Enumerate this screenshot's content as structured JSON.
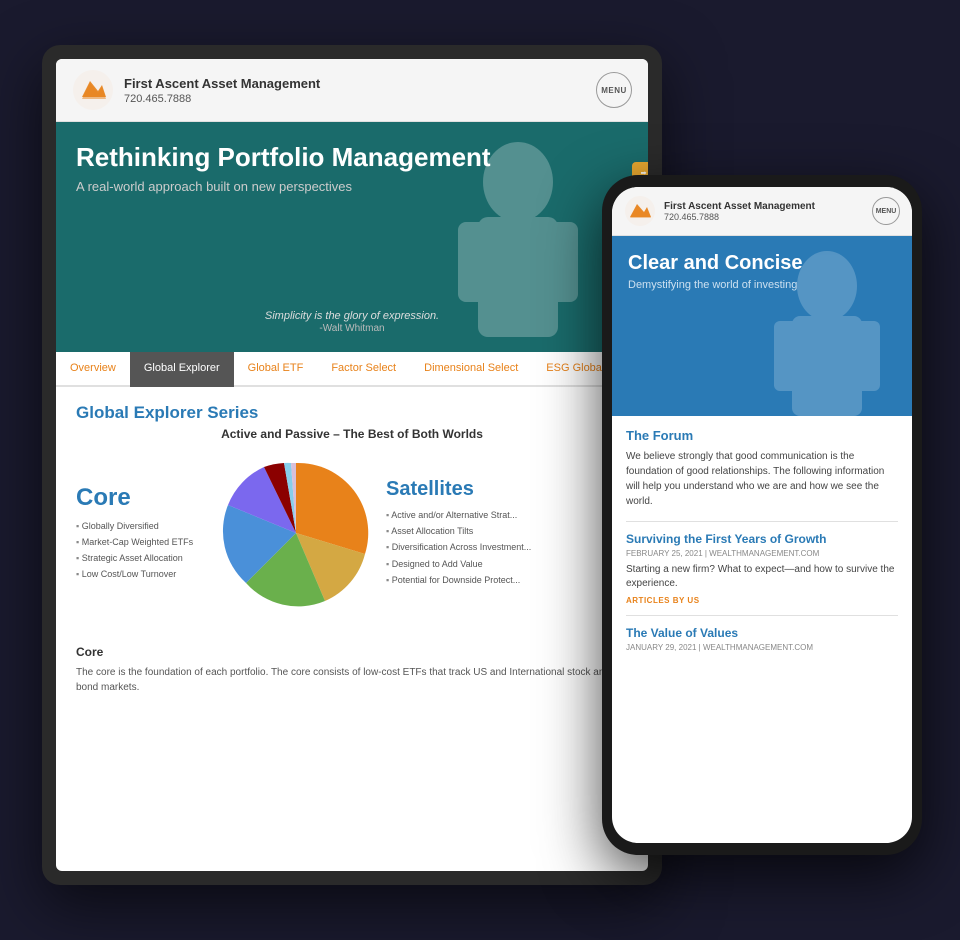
{
  "desktop": {
    "header": {
      "company_name": "First Ascent Asset Management",
      "phone": "720.465.7888",
      "menu_label": "MENU"
    },
    "hero": {
      "title": "Rethinking Portfolio Management",
      "subtitle": "A real-world approach built on new perspectives",
      "quote": "Simplicity is the glory of expression.",
      "quote_attribution": "-Walt Whitman"
    },
    "tabs": [
      {
        "label": "Overview",
        "active": false
      },
      {
        "label": "Global Explorer",
        "active": true
      },
      {
        "label": "Global ETF",
        "active": false
      },
      {
        "label": "Factor Select",
        "active": false
      },
      {
        "label": "Dimensional Select",
        "active": false
      },
      {
        "label": "ESG Global Core",
        "active": false
      }
    ],
    "section_title": "Global Explorer Series",
    "chart_title": "Active and Passive – The Best of Both Worlds",
    "core": {
      "label": "Core",
      "items": [
        "Globally Diversified",
        "Market-Cap Weighted ETFs",
        "Strategic Asset Allocation",
        "Low Cost/Low Turnover"
      ]
    },
    "satellites": {
      "label": "Satellites",
      "items": [
        "Active and/or Alternative Strat...",
        "Asset Allocation Tilts",
        "Diversification Across Investment...",
        "Designed to Add Value",
        "Potential for Downside Protect..."
      ]
    },
    "bottom_section": {
      "title": "Core",
      "text": "The core is the foundation of each portfolio.  The core consists of low-cost ETFs that track US and International stock and bond markets."
    },
    "pie_segments": [
      {
        "color": "#e8821a",
        "start": 0,
        "sweep": 85
      },
      {
        "color": "#d4a843",
        "start": 85,
        "sweep": 60
      },
      {
        "color": "#6ab04c",
        "start": 145,
        "sweep": 55
      },
      {
        "color": "#4a90d9",
        "start": 200,
        "sweep": 80
      },
      {
        "color": "#7b68ee",
        "start": 280,
        "sweep": 30
      },
      {
        "color": "#8b0000",
        "start": 310,
        "sweep": 20
      },
      {
        "color": "#87ceeb",
        "start": 330,
        "sweep": 15
      },
      {
        "color": "#d8bfd8",
        "start": 345,
        "sweep": 15
      }
    ]
  },
  "mobile": {
    "header": {
      "company_name": "First Ascent Asset Management",
      "phone": "720.465.7888",
      "menu_label": "MENU"
    },
    "hero": {
      "title": "Clear and Concise",
      "subtitle": "Demystifying the world of investing"
    },
    "forum": {
      "title": "The Forum",
      "body": "We believe strongly that good communication is the foundation of good relationships. The following information will help you understand who we are and how we see the world."
    },
    "articles": [
      {
        "title": "Surviving the First Years of Growth",
        "date": "February 25, 2021",
        "source": "WEALTHMANAGEMENT.COM",
        "excerpt": "Starting a new firm? What to expect—and how to survive the experience.",
        "tag": "ARTICLES BY US"
      },
      {
        "title": "The Value of Values",
        "date": "January 29, 2021",
        "source": "WEALTHMANAGEMENT.COM",
        "excerpt": "",
        "tag": ""
      }
    ]
  }
}
